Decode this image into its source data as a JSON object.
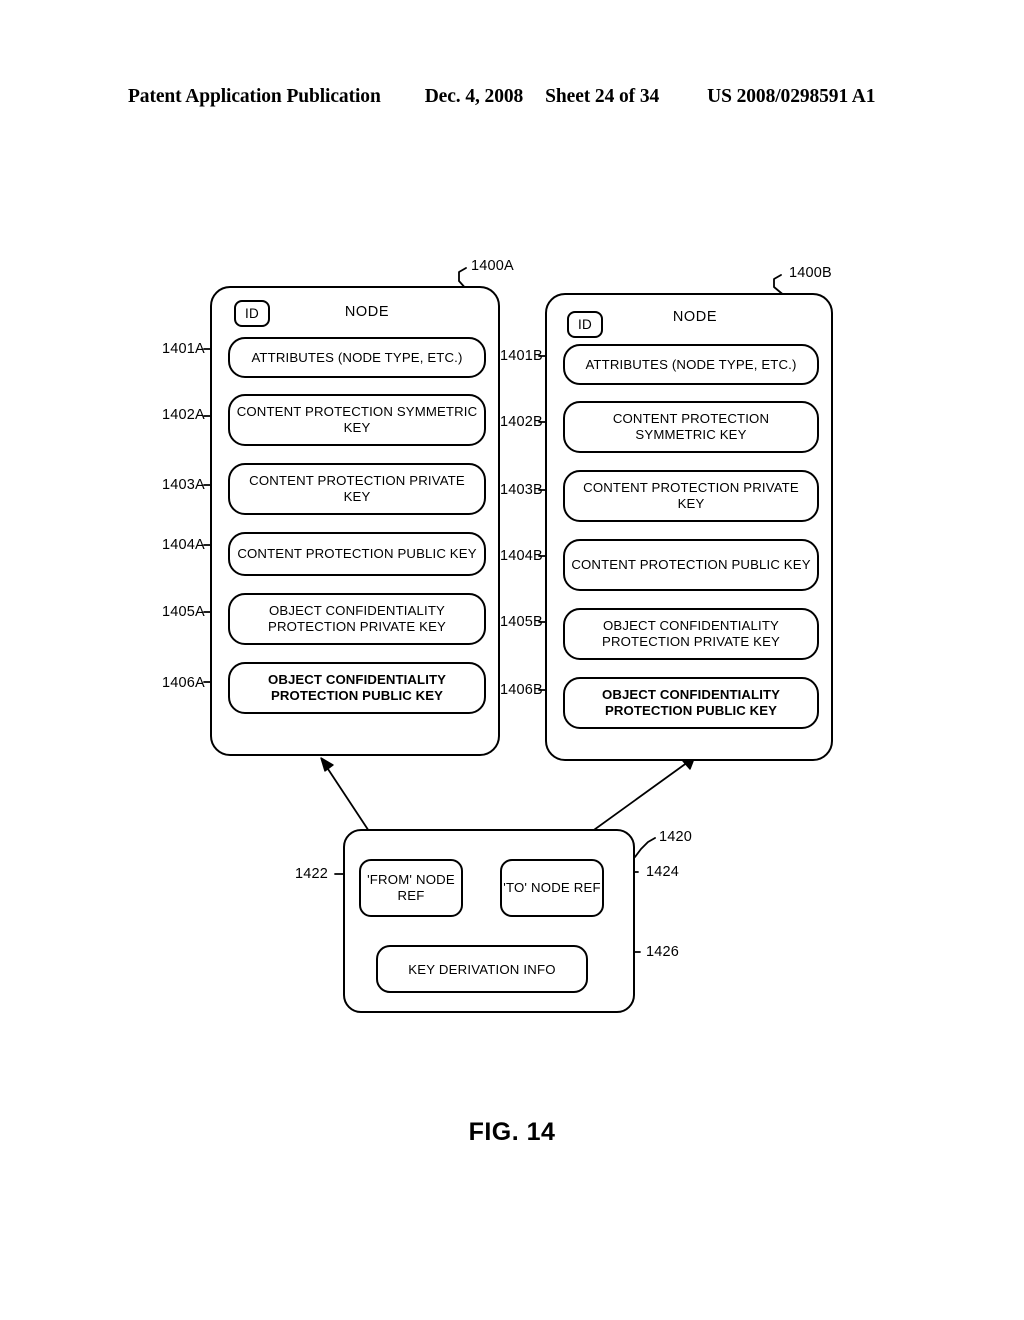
{
  "header": {
    "publication": "Patent Application Publication",
    "date": "Dec. 4, 2008",
    "sheet": "Sheet 24 of 34",
    "patent_number": "US 2008/0298591 A1"
  },
  "figure": {
    "caption": "FIG. 14"
  },
  "nodes": [
    {
      "ref": "1400A",
      "id_badge": "ID",
      "title": "NODE",
      "fields": [
        {
          "ref": "1401A",
          "label": "ATTRIBUTES (NODE TYPE, ETC.)",
          "bold": false
        },
        {
          "ref": "1402A",
          "label": "CONTENT PROTECTION SYMMETRIC KEY",
          "bold": false
        },
        {
          "ref": "1403A",
          "label": "CONTENT PROTECTION PRIVATE KEY",
          "bold": false
        },
        {
          "ref": "1404A",
          "label": "CONTENT PROTECTION PUBLIC KEY",
          "bold": false
        },
        {
          "ref": "1405A",
          "label": "OBJECT CONFIDENTIALITY PROTECTION PRIVATE KEY",
          "bold": false
        },
        {
          "ref": "1406A",
          "label": "OBJECT CONFIDENTIALITY PROTECTION PUBLIC KEY",
          "bold": true
        }
      ]
    },
    {
      "ref": "1400B",
      "id_badge": "ID",
      "title": "NODE",
      "fields": [
        {
          "ref": "1401B",
          "label": "ATTRIBUTES (NODE TYPE, ETC.)",
          "bold": false
        },
        {
          "ref": "1402B",
          "label": "CONTENT PROTECTION SYMMETRIC KEY",
          "bold": false
        },
        {
          "ref": "1403B",
          "label": "CONTENT PROTECTION PRIVATE KEY",
          "bold": false
        },
        {
          "ref": "1404B",
          "label": "CONTENT PROTECTION PUBLIC KEY",
          "bold": false
        },
        {
          "ref": "1405B",
          "label": "OBJECT CONFIDENTIALITY PROTECTION PRIVATE KEY",
          "bold": false
        },
        {
          "ref": "1406B",
          "label": "OBJECT CONFIDENTIALITY PROTECTION PUBLIC KEY",
          "bold": true
        }
      ]
    }
  ],
  "link": {
    "ref": "1420",
    "from_ref_box": {
      "ref": "1422",
      "label": "'FROM' NODE REF"
    },
    "to_ref_box": {
      "ref": "1424",
      "label": "'TO' NODE REF"
    },
    "key_derivation": {
      "ref": "1426",
      "label": "KEY DERIVATION INFO"
    }
  },
  "colors": {
    "ink": "#000000",
    "paper": "#ffffff"
  }
}
